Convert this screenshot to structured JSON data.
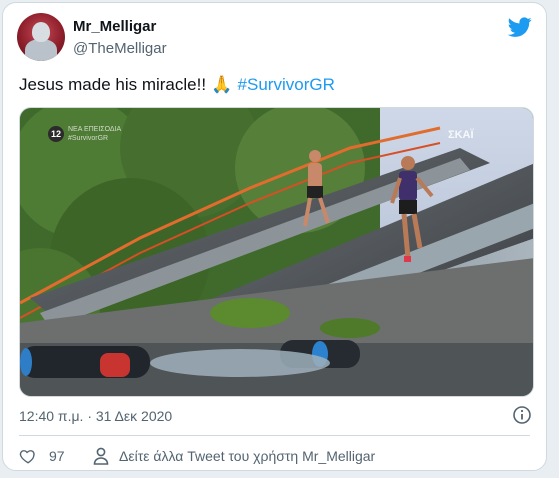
{
  "author": {
    "display_name": "Mr_Melligar",
    "handle": "@TheMelligar"
  },
  "tweet": {
    "text_main": "Jesus made his miracle!!",
    "emoji": "🙏",
    "hashtag": "#SurvivorGR"
  },
  "media": {
    "channel_badge": "12",
    "overlay_text": "ΝΕΑ ΕΠΕΙΣΟΔΙΑ #SurvivorGR",
    "broadcaster_watermark": "ΣΚΑΪ"
  },
  "meta": {
    "timestamp": "12:40 π.μ. · 31 Δεκ 2020"
  },
  "actions": {
    "like_count": "97",
    "see_more_label": "Δείτε άλλα Tweet του χρήστη Mr_Melligar"
  },
  "colors": {
    "accent": "#1d9bf0",
    "text_primary": "#0f1419",
    "text_secondary": "#536471"
  },
  "icons": [
    "twitter-bird-icon",
    "info-icon",
    "heart-icon",
    "person-icon"
  ]
}
